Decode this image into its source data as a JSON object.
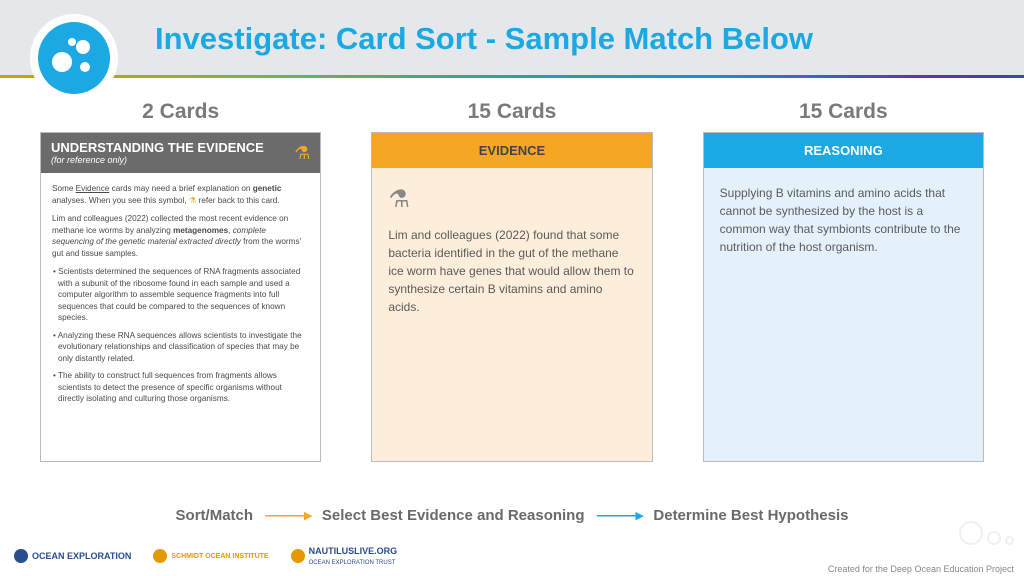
{
  "header": {
    "title": "Investigate: Card Sort - Sample Match Below"
  },
  "columns": {
    "understanding": {
      "count_label": "2 Cards",
      "title": "UNDERSTANDING THE EVIDENCE",
      "subtitle": "(for reference only)",
      "p1_a": "Some ",
      "p1_u": "Evidence",
      "p1_b": " cards may need a brief explanation on ",
      "p1_bold": "genetic",
      "p1_c": " analyses. When you see this symbol, ",
      "p1_d": " refer back to this card.",
      "p2_a": "Lim and colleagues (2022) collected the most recent evidence on methane ice worms by analyzing ",
      "p2_bold": "metagenomes",
      "p2_b": ", ",
      "p2_em": "complete sequencing of the genetic material extracted directly",
      "p2_c": " from the worms' gut and tissue samples.",
      "b1": "• Scientists determined the sequences of RNA fragments associated with a subunit of the ribosome found in each sample and used a computer algorithm to assemble sequence fragments into full sequences that could be compared to the sequences of known species.",
      "b2": "• Analyzing these RNA sequences allows scientists to investigate the evolutionary relationships and classification of species that may be only distantly related.",
      "b3": "• The ability to construct full sequences from fragments allows scientists to detect the presence of specific organisms without directly isolating and culturing those organisms."
    },
    "evidence": {
      "count_label": "15 Cards",
      "title": "EVIDENCE",
      "body": "Lim and colleagues (2022) found that some bacteria identified in the gut of the methane ice worm have genes that would allow them to synthesize certain B vitamins and amino acids."
    },
    "reasoning": {
      "count_label": "15 Cards",
      "title": "REASONING",
      "body": "Supplying B vitamins and amino acids that cannot be synthesized by the host is a common way that symbionts contribute to the nutrition of the host organism."
    }
  },
  "flow": {
    "step1": "Sort/Match",
    "step2": "Select Best Evidence and Reasoning",
    "step3": "Determine Best Hypothesis"
  },
  "footer": {
    "logo1": "OCEAN EXPLORATION",
    "logo2": "SCHMIDT OCEAN INSTITUTE",
    "logo3a": "NAUTILUSLIVE.ORG",
    "logo3b": "OCEAN EXPLORATION TRUST",
    "credit": "Created for the Deep Ocean Education Project"
  }
}
